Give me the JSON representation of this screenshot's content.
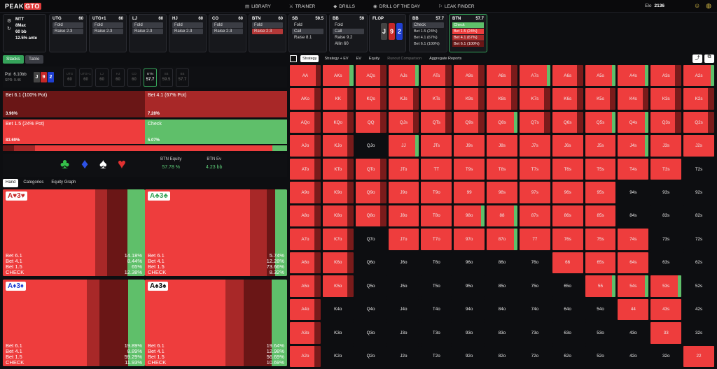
{
  "nav": {
    "logo_a": "PEAK",
    "logo_b": "GTO",
    "items": [
      {
        "icon": "book-icon",
        "glyph": "▤",
        "label": "LIBRARY"
      },
      {
        "icon": "trainer-icon",
        "glyph": "⚔",
        "label": "TRAINER"
      },
      {
        "icon": "drills-icon",
        "glyph": "◆",
        "label": "DRILLS"
      },
      {
        "icon": "calendar-icon",
        "glyph": "◉",
        "label": "DRILL OF THE DAY"
      },
      {
        "icon": "leak-icon",
        "glyph": "⚐",
        "label": "LEAK FINDER"
      }
    ],
    "elo_label": "Elo",
    "elo_value": "2136"
  },
  "game": {
    "type": "MTT",
    "format": "8Max",
    "stack": "60 bb",
    "ante": "12.5% ante"
  },
  "positions": [
    {
      "name": "UTG",
      "stack": "60",
      "a1": "Fold",
      "a2": "Raise 2.3"
    },
    {
      "name": "UTG+1",
      "stack": "60",
      "a1": "Fold",
      "a2": "Raise 2.3"
    },
    {
      "name": "LJ",
      "stack": "60",
      "a1": "Fold",
      "a2": "Raise 2.3"
    },
    {
      "name": "HJ",
      "stack": "60",
      "a1": "Fold",
      "a2": "Raise 2.3"
    },
    {
      "name": "CO",
      "stack": "60",
      "a1": "Fold",
      "a2": "Raise 2.3"
    },
    {
      "name": "BTN",
      "stack": "60",
      "a1": "Fold",
      "a2": "Raise 2.3"
    },
    {
      "name": "SB",
      "stack": "59.5",
      "a1": "Fold",
      "a2": "Call",
      "a3": "Raise 8.1"
    },
    {
      "name": "BB",
      "stack": "59",
      "a1": "Fold",
      "a2": "Call",
      "a3": "Raise 9.2",
      "a4": "Allin 60"
    }
  ],
  "flop": {
    "label": "FLOP",
    "cards": [
      "J",
      "9",
      "2"
    ]
  },
  "bb_card": {
    "name": "BB",
    "stack": "57.7",
    "a1": "Check",
    "a2": "Bet 1.5 (24%)",
    "a3": "Bet 4.1 (67%)",
    "a4": "Bet 6.1 (100%)"
  },
  "btn_card": {
    "name": "BTN",
    "stack": "57.7",
    "a1": "Check",
    "a2": "Bet 1.5 (24%)",
    "a3": "Bet 4.1 (67%)",
    "a4": "Bet 6.1 (100%)"
  },
  "left_tabs": {
    "stacks": "Stacks",
    "table": "Table"
  },
  "pot": {
    "label": "Pot",
    "value": "6.10bb",
    "spr": "SPR: 9.46",
    "cards": [
      "J",
      "9",
      "2"
    ],
    "seats": [
      {
        "n": "UTG",
        "s": "60"
      },
      {
        "n": "UTG+1",
        "s": "60"
      },
      {
        "n": "LJ",
        "s": "60"
      },
      {
        "n": "HJ",
        "s": "60"
      },
      {
        "n": "CO",
        "s": "60"
      },
      {
        "n": "BTN",
        "s": "57.7"
      },
      {
        "n": "SB",
        "s": "59.5"
      },
      {
        "n": "BB",
        "s": "57.7"
      }
    ]
  },
  "strategy": [
    {
      "label": "Bet 6.1 (100% Pot)",
      "pct": "3.96%",
      "color": "#6a1616"
    },
    {
      "label": "Bet 4.1 (67% Pot)",
      "pct": "7.28%",
      "color": "#a82828"
    },
    {
      "label": "Bet 1.5 (24% Pot)",
      "pct": "83.69%",
      "color": "#ee3d3d"
    },
    {
      "label": "Check",
      "pct": "5.07%",
      "color": "#5fbf6a"
    }
  ],
  "strategy_bar": [
    0.0396,
    0.0728,
    0.8369,
    0.0507
  ],
  "suits": [
    "♣",
    "♦",
    "♠",
    "♥"
  ],
  "equity": {
    "label": "BTN Equity",
    "value": "57.78 %"
  },
  "ev": {
    "label": "BTN Ev",
    "value": "4.23 bb"
  },
  "hand_tabs": {
    "hand": "Hand",
    "categories": "Categories",
    "graph": "Equity Graph"
  },
  "hands": [
    {
      "label": "A♥3♥",
      "rows": [
        [
          "Bet 6.1",
          "14.18%"
        ],
        [
          "Bet 4.1",
          "8.44%"
        ],
        [
          "Bet 1.5",
          "65%"
        ],
        [
          "CHECK",
          "12.38%"
        ]
      ],
      "mix": [
        0.1418,
        0.0844,
        0.65,
        0.1238
      ]
    },
    {
      "label": "A♣3♣",
      "rows": [
        [
          "Bet 6.1",
          "5.74%"
        ],
        [
          "Bet 4.1",
          "12.28%"
        ],
        [
          "Bet 1.5",
          "73.66%"
        ],
        [
          "CHECK",
          "8.32%"
        ]
      ],
      "mix": [
        0.0574,
        0.1228,
        0.7366,
        0.0832
      ]
    },
    {
      "label": "A♦3♦",
      "rows": [
        [
          "Bet 6.1",
          "19.89%"
        ],
        [
          "Bet 4.1",
          "8.89%"
        ],
        [
          "Bet 1.5",
          "59.29%"
        ],
        [
          "CHECK",
          "11.93%"
        ]
      ],
      "mix": [
        0.1989,
        0.0889,
        0.5929,
        0.1193
      ]
    },
    {
      "label": "A♠3♠",
      "rows": [
        [
          "Bet 6.1",
          "19.64%"
        ],
        [
          "Bet 4.1",
          "12.98%"
        ],
        [
          "Bet 1.5",
          "56.69%"
        ],
        [
          "CHECK",
          "10.69%"
        ]
      ],
      "mix": [
        0.1964,
        0.1298,
        0.5669,
        0.1069
      ]
    }
  ],
  "right_tabs": [
    "Strategy",
    "Strategy + EV",
    "EV",
    "Equity",
    "Runout Comparison",
    "Aggregate Reports"
  ],
  "grid_rows": [
    "AA AKs AQs AJs ATs A9s A8s A7s A6s A5s A4s A3s A2s",
    "AKo KK KQs KJs KTs K9s K8s K7s K6s K5s K4s K3s K2s",
    "AQo KQo QQ QJs QTs Q9s Q8s Q7s Q6s Q5s Q4s Q3s Q2s",
    "AJo KJo QJo JJ JTs J9s J8s J7s J6s J5s J4s J3s J2s",
    "ATo KTo QTo JTo TT T9s T8s T7s T6s T5s T4s T3s T2s",
    "A9o K9o Q9o J9o T9o 99 98s 97s 96s 95s 94s 93s 92s",
    "A8o K8o Q8o J8o T8o 98o 88 87s 86s 85s 84s 83s 82s",
    "A7o K7o Q7o J7o T7o 97o 87o 77 76s 75s 74s 73s 72s",
    "A6o K6o Q6o J6o T6o 96o 86o 76o 66 65s 64s 63s 62s",
    "A5o K5o Q5o J5o T5o 95o 85o 75o 65o 55 54s 53s 52s",
    "A4o K4o Q4o J4o T4o 94o 84o 74o 64o 54o 44 43s 42s",
    "A3o K3o Q3o J3o T3o 93o 83o 73o 63o 53o 43o 33 32s",
    "A2o K2o Q2o J2o T2o 92o 82o 72o 62o 52o 42o 32o 22"
  ],
  "grid_active": [
    "1111111111111",
    "1111111111111",
    "1111111111111",
    "1101111111111",
    "1111111111110",
    "1111111111000",
    "1111111111000",
    "1101111111100",
    "1100000011100",
    "1100000001110",
    "1000000000110",
    "1000000000010",
    "1000000000001"
  ],
  "grid_green": [
    "0101000101101",
    "0000000000000",
    "0000001001100",
    "0001000000100",
    "0000000000000",
    "0000000000000",
    "0000011000000",
    "0000001000000",
    "0000000000000",
    "0000000001110",
    "0000000000000",
    "0000000000000",
    "0000000000000"
  ]
}
